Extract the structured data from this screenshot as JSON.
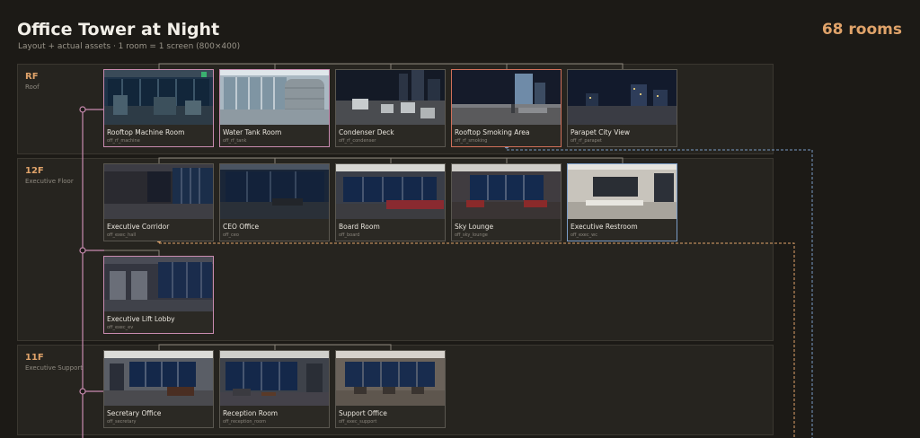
{
  "header": {
    "title": "Office Tower at Night",
    "subtitle": "Layout + actual assets · 1 room = 1 screen (800×400)",
    "room_count": "68 rooms"
  },
  "floors": [
    {
      "code": "RF",
      "name": "Roof",
      "rooms": [
        {
          "title": "Rooftop Machine Room",
          "id": "off_rf_machine"
        },
        {
          "title": "Water Tank Room",
          "id": "off_rf_tank"
        },
        {
          "title": "Condenser Deck",
          "id": "off_rf_condenser"
        },
        {
          "title": "Rooftop Smoking Area",
          "id": "off_rf_smoking"
        },
        {
          "title": "Parapet City View",
          "id": "off_rf_parapet"
        }
      ]
    },
    {
      "code": "12F",
      "name": "Executive Floor",
      "rooms": [
        {
          "title": "Executive Corridor",
          "id": "off_exec_hall"
        },
        {
          "title": "CEO Office",
          "id": "off_ceo"
        },
        {
          "title": "Board Room",
          "id": "off_board"
        },
        {
          "title": "Sky Lounge",
          "id": "off_sky_lounge"
        },
        {
          "title": "Executive Restroom",
          "id": "off_exec_wc"
        },
        {
          "title": "Executive Lift Lobby",
          "id": "off_exec_ev"
        }
      ]
    },
    {
      "code": "11F",
      "name": "Executive Support",
      "rooms": [
        {
          "title": "Secretary Office",
          "id": "off_secretary"
        },
        {
          "title": "Reception Room",
          "id": "off_reception_room"
        },
        {
          "title": "Support Office",
          "id": "off_exec_support"
        }
      ]
    }
  ],
  "colors": {
    "accent": "#e0a36a",
    "elevator_link": "#c98bb0",
    "stair_link_blue": "#7a9cc6",
    "stair_link_orange": "#e0a36a"
  }
}
